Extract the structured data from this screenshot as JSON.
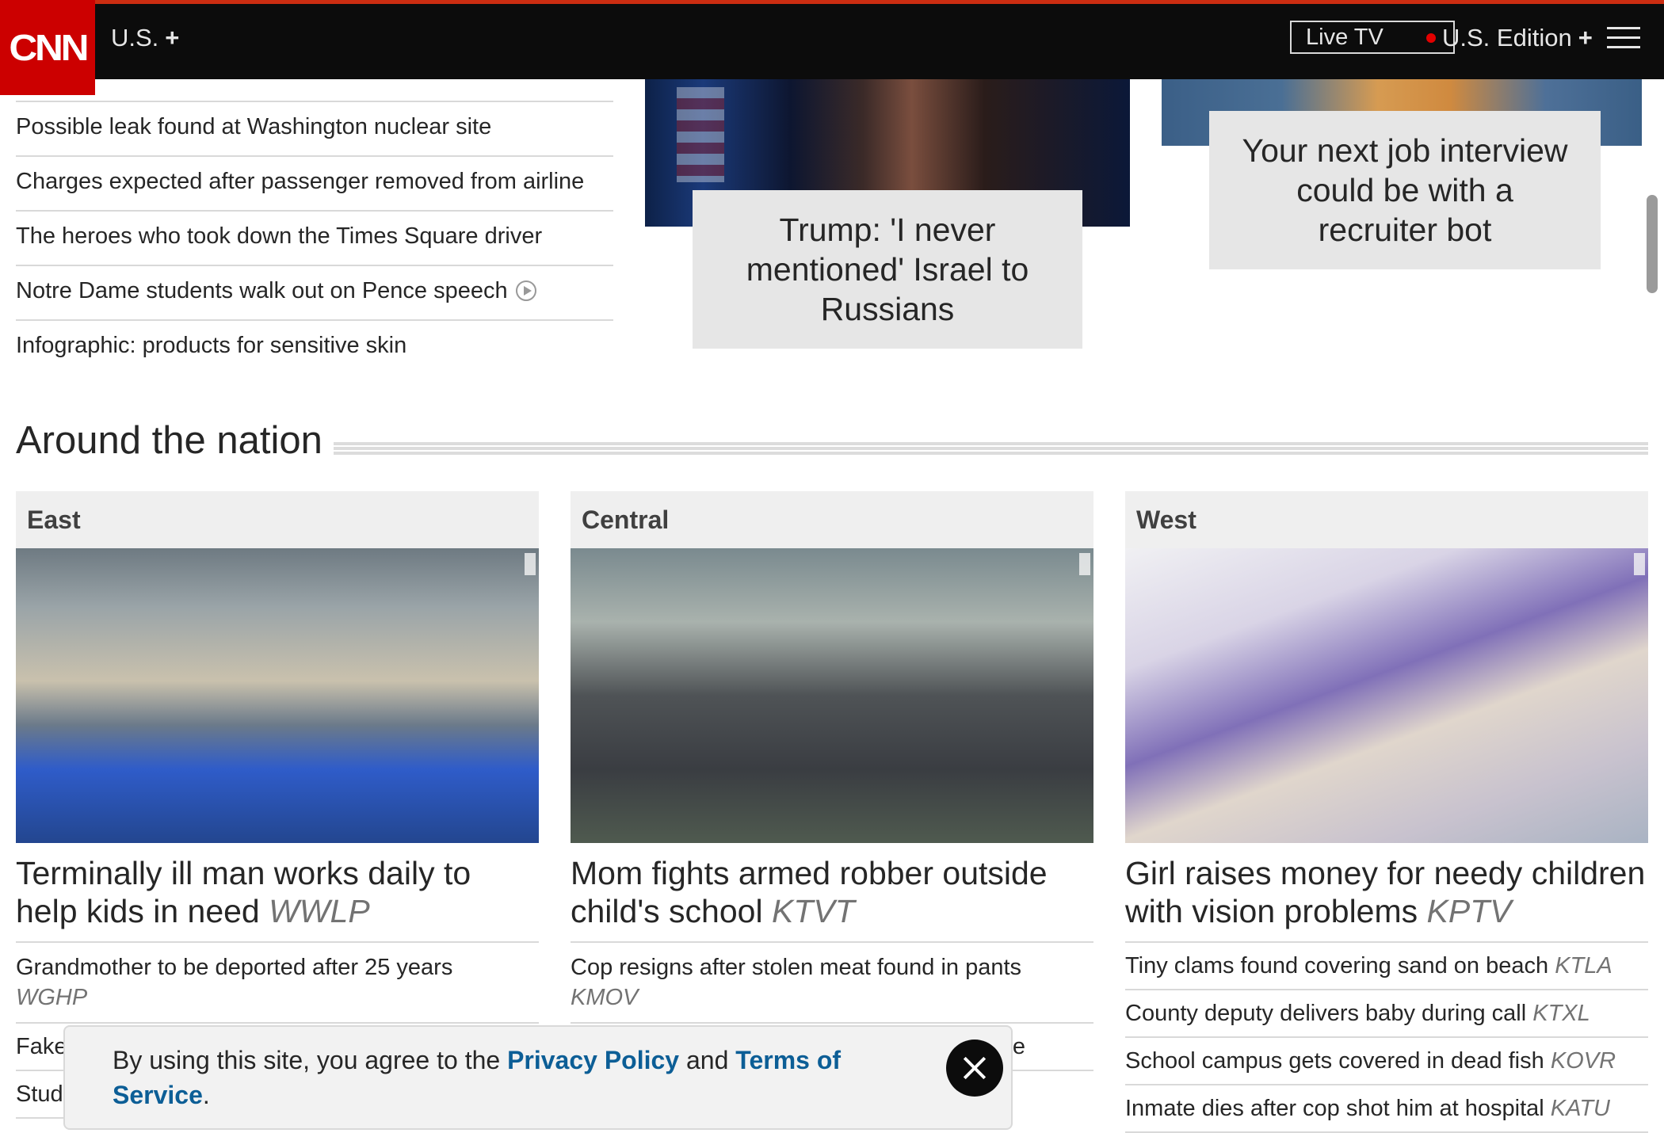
{
  "nav": {
    "logo": "CNN",
    "section": "U.S.",
    "section_plus": "+",
    "live_tv": "Live TV",
    "edition": "U.S. Edition",
    "edition_plus": "+",
    "icons": [
      "menu-icon",
      "live-dot-icon"
    ]
  },
  "top_headlines": [
    "Possible leak found at Washington nuclear site",
    "Charges expected after passenger removed from airline",
    "The heroes who took down the Times Square driver",
    "Notre Dame students walk out on Pence speech",
    "Infographic: products for sensitive skin"
  ],
  "features": {
    "trump_caption": "Trump: 'I never mentioned' Israel to Russians",
    "job_caption": "Your next job interview could be with a recruiter bot"
  },
  "section": {
    "title": "Around the nation"
  },
  "columns": {
    "east": {
      "label": "East",
      "headline": "Terminally ill man works daily to help kids in need",
      "source": "WWLP",
      "items": [
        {
          "text": "Grandmother to be deported after 25 years",
          "source": "WGHP"
        },
        {
          "text": "Fake",
          "source": ""
        },
        {
          "text": "Stud",
          "source": ""
        }
      ]
    },
    "central": {
      "label": "Central",
      "headline": "Mom fights armed robber outside child's school",
      "source": "KTVT",
      "items": [
        {
          "text": "Cop resigns after stolen meat found in pants",
          "source": "KMOV"
        },
        {
          "text": "e",
          "source": ""
        }
      ]
    },
    "west": {
      "label": "West",
      "headline": "Girl raises money for needy children with vision problems",
      "source": "KPTV",
      "items": [
        {
          "text": "Tiny clams found covering sand on beach",
          "source": "KTLA"
        },
        {
          "text": "County deputy delivers baby during call",
          "source": "KTXL"
        },
        {
          "text": "School campus gets covered in dead fish",
          "source": "KOVR"
        },
        {
          "text": "Inmate dies after cop shot him at hospital",
          "source": "KATU"
        }
      ]
    }
  },
  "consent": {
    "prefix": "By using this site, you agree to the ",
    "privacy": "Privacy Policy",
    "and": " and ",
    "terms": "Terms of Service",
    "suffix": "."
  },
  "colors": {
    "brand": "#cc0000",
    "link": "#0c5e96",
    "nav_bg": "#0c0c0c"
  }
}
